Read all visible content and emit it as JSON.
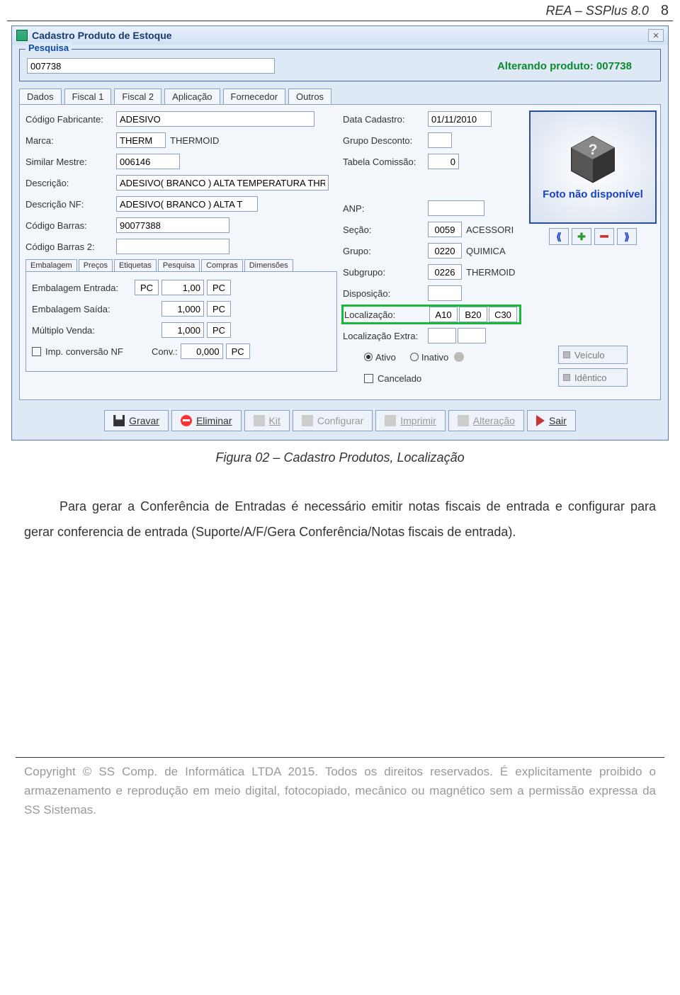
{
  "header": {
    "doc_title": "REA – SSPlus 8.0",
    "page_num": "8"
  },
  "window": {
    "title": "Cadastro Produto de Estoque",
    "close_glyph": "✕",
    "search": {
      "legend": "Pesquisa",
      "value": "007738",
      "status": "Alterando produto: 007738"
    },
    "tabs": [
      "Dados",
      "Fiscal 1",
      "Fiscal 2",
      "Aplicação",
      "Fornecedor",
      "Outros"
    ],
    "fields_left": {
      "cod_fabricante": {
        "label": "Código Fabricante:",
        "value": "ADESIVO"
      },
      "marca": {
        "label": "Marca:",
        "value": "THERM",
        "after": "THERMOID"
      },
      "similar": {
        "label": "Similar Mestre:",
        "value": "006146"
      },
      "descricao": {
        "label": "Descrição:",
        "value": "ADESIVO( BRANCO ) ALTA TEMPERATURA THREEBOND"
      },
      "descricao_nf": {
        "label": "Descrição NF:",
        "value": "ADESIVO( BRANCO ) ALTA T"
      },
      "cod_barras": {
        "label": "Código Barras:",
        "value": "90077388"
      },
      "cod_barras2": {
        "label": "Código Barras 2:",
        "value": ""
      }
    },
    "subtabs": [
      "Embalagem",
      "Preços",
      "Etiquetas",
      "Pesquisa",
      "Compras",
      "Dimensões"
    ],
    "embalagem": {
      "entrada": {
        "label": "Embalagem Entrada:",
        "unit1": "PC",
        "qty": "1,00",
        "unit2": "PC"
      },
      "saida": {
        "label": "Embalagem Saída:",
        "qty": "1,000",
        "unit2": "PC"
      },
      "multiplo": {
        "label": "Múltiplo Venda:",
        "qty": "1,000",
        "unit2": "PC"
      },
      "imp_conv": {
        "label": "Imp. conversão NF",
        "conv_label": "Conv.:",
        "conv_val": "0,000",
        "conv_unit": "PC"
      }
    },
    "fields_mid": {
      "data_cad": {
        "label": "Data Cadastro:",
        "value": "01/11/2010"
      },
      "grupo_desc": {
        "label": "Grupo Desconto:",
        "value": ""
      },
      "tab_com": {
        "label": "Tabela Comissão:",
        "value": "0"
      },
      "anp": {
        "label": "ANP:",
        "value": ""
      },
      "secao": {
        "label": "Seção:",
        "value": "0059",
        "after": "ACESSORI"
      },
      "grupo": {
        "label": "Grupo:",
        "value": "0220",
        "after": "QUIMICA"
      },
      "subgrupo": {
        "label": "Subgrupo:",
        "value": "0226",
        "after": "THERMOID"
      },
      "disposicao": {
        "label": "Disposição:",
        "value": ""
      },
      "localizacao": {
        "label": "Localização:",
        "v1": "A10",
        "v2": "B20",
        "v3": "C30"
      },
      "loc_extra": {
        "label": "Localização Extra:",
        "v1": "",
        "v2": ""
      },
      "status": {
        "ativo": "Ativo",
        "inativo": "Inativo"
      },
      "cancelado": "Cancelado"
    },
    "photo": {
      "caption": "Foto não disponível",
      "first": "⟪",
      "add": "✚",
      "remove": "━",
      "last": "⟫"
    },
    "side_buttons": {
      "veiculo": "Veículo",
      "identico": "Idêntico"
    },
    "buttons": {
      "gravar": "Gravar",
      "eliminar": "Eliminar",
      "kit": "Kit",
      "configurar": "Configurar",
      "imprimir": "Imprimir",
      "alteracao": "Alteração",
      "sair": "Sair"
    }
  },
  "caption": "Figura 02 – Cadastro Produtos, Localização",
  "paragraph": "Para gerar a Conferência de Entradas é necessário emitir notas fiscais de entrada e configurar para gerar conferencia de entrada (Suporte/A/F/Gera Conferência/Notas fiscais de entrada).",
  "footer": "Copyright © SS Comp. de Informática LTDA 2015. Todos os direitos reservados. É explicitamente proibido o armazenamento e reprodução em meio digital, fotocopiado, mecânico ou magnético sem a permissão expressa da SS Sistemas."
}
